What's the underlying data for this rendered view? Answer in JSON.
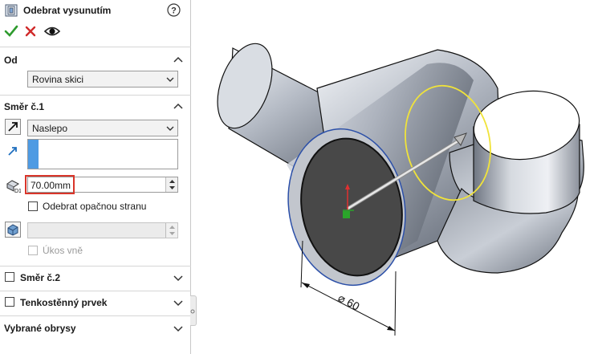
{
  "panel": {
    "title": "Odebrat vysunutím",
    "help_icon": "help-circle-icon",
    "actions": {
      "ok_icon": "checkmark-icon",
      "cancel_icon": "close-icon",
      "preview_icon": "eye-icon"
    },
    "from_section": {
      "title": "Od",
      "selected": "Rovina skici"
    },
    "direction1": {
      "title": "Směr č.1",
      "end_condition": "Naslepo",
      "depth": "70.00mm",
      "flip_side_label": "Odebrat opačnou stranu",
      "draft_value": "",
      "draft_outward_label": "Úkos vně"
    },
    "direction2": {
      "title": "Směr č.2"
    },
    "thin_feature": {
      "title": "Tenkostěnný prvek"
    },
    "selected_contours": {
      "title": "Vybrané obrysy"
    }
  },
  "viewport": {
    "dimension_label": "⌀ 60",
    "colors": {
      "accent_selection": "#4e9be3",
      "highlight_box": "#d9352a",
      "preview_circle": "#f0e33a",
      "face_dark": "#484848"
    }
  }
}
